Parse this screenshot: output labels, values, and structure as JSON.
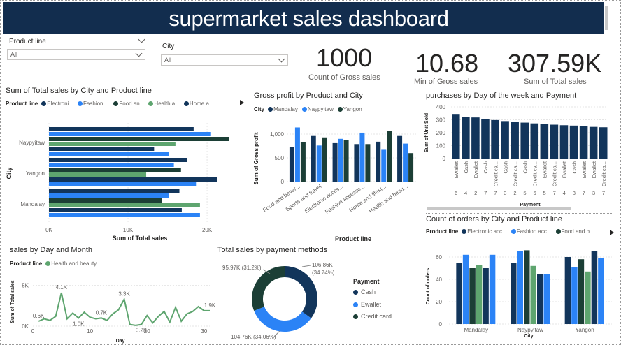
{
  "header": {
    "title": "supermarket sales dashboard"
  },
  "slicers": {
    "product_line": {
      "label": "Product line",
      "value": "All"
    },
    "city": {
      "label": "City",
      "value": "All"
    }
  },
  "kpis": [
    {
      "value": "1000",
      "label": "Count of Gross sales"
    },
    {
      "value": "10.68",
      "label": "Min of Gross sales"
    },
    {
      "value": "307.59K",
      "label": "Sum of Total sales"
    }
  ],
  "colors": {
    "navy": "#12355b",
    "blue": "#2b83f6",
    "darkgreen": "#1c3f36",
    "green": "#5ea56f",
    "titlebar": "#122d4e"
  },
  "visual1": {
    "title": "Sum of Total sales by City and Product line",
    "legend_title": "Product line",
    "legend": [
      "Electroni...",
      "Fashion ...",
      "Food an...",
      "Health a...",
      "Home a..."
    ],
    "xlabel": "Sum of Total sales",
    "ylabel": "City",
    "xticks": [
      "0K",
      "10K",
      "20K"
    ]
  },
  "visual2": {
    "title": "Gross profit by Product and City",
    "legend_title": "City",
    "legend": [
      "Mandalay",
      "Naypyitaw",
      "Yangon"
    ],
    "xlabel": "Product line",
    "ylabel": "Sum of Gross profit",
    "yticks": [
      "0",
      "500",
      "1,000"
    ]
  },
  "visual3": {
    "title": "purchases by Day of the week and Payment",
    "xlabel": "Payment",
    "ylabel": "Sum of Unit Sold",
    "yticks": [
      "0",
      "100",
      "200",
      "300",
      "400"
    ]
  },
  "visual4": {
    "title": "sales by Day and Month",
    "legend_title": "Product line",
    "legend": [
      "Health and beauty"
    ],
    "xlabel": "Day",
    "ylabel": "Sum of Total sales",
    "yticks": [
      "0K",
      "5K"
    ],
    "xticks": [
      "0",
      "10",
      "20",
      "30"
    ]
  },
  "visual5": {
    "title": "Total sales by payment methods",
    "legend_title": "Payment",
    "legend": [
      "Cash",
      "Ewallet",
      "Credit card"
    ],
    "labels": [
      {
        "line1": "106.86K",
        "line2": "(34.74%)"
      },
      {
        "line1": "95.97K (31.2%)"
      },
      {
        "line1": "104.76K (34.06%)"
      }
    ]
  },
  "visual6": {
    "title": "Count of orders by City and Product line",
    "legend_title": "Product line",
    "legend": [
      "Electronic acc...",
      "Fashion acc...",
      "Food and b..."
    ],
    "xlabel": "City",
    "ylabel": "Count of orders",
    "yticks": [
      "0",
      "20",
      "40",
      "60"
    ]
  },
  "chart_data": [
    {
      "type": "bar",
      "title": "Sum of Total sales by City and Product line",
      "orientation": "horizontal",
      "categories": [
        "Naypyitaw",
        "Yangon",
        "Mandalay"
      ],
      "series": [
        {
          "name": "Electroni...",
          "values": [
            18300,
            17500,
            16500
          ]
        },
        {
          "name": "Fashion ...",
          "values": [
            20500,
            15800,
            15200
          ]
        },
        {
          "name": "Food an...",
          "values": [
            22800,
            16700,
            14300
          ]
        },
        {
          "name": "Health a...",
          "values": [
            16000,
            12300,
            19100
          ]
        },
        {
          "name": "Home a...",
          "values": [
            13300,
            21300,
            16800
          ]
        },
        {
          "name": "",
          "values": [
            15200,
            18600,
            19100
          ]
        }
      ],
      "xlim": [
        0,
        23000
      ]
    },
    {
      "type": "bar",
      "title": "Gross profit by Product and City",
      "categories": [
        "Food and bever...",
        "Sports and travel",
        "Electronic acces...",
        "Fashion accesso...",
        "Home and lifest...",
        "Health and beau..."
      ],
      "series": [
        {
          "name": "Mandalay",
          "values": [
            730,
            960,
            810,
            790,
            840,
            960
          ]
        },
        {
          "name": "Naypyitaw",
          "values": [
            1140,
            760,
            900,
            1030,
            670,
            800
          ]
        },
        {
          "name": "Yangon",
          "values": [
            830,
            930,
            870,
            790,
            1060,
            600
          ]
        }
      ],
      "ylim": [
        0,
        1250
      ]
    },
    {
      "type": "bar",
      "title": "purchases by Day of the week and Payment",
      "categories": [
        "Ewallet 6",
        "Cash 4",
        "Ewallet 2",
        "Cash 7",
        "Credit ca... 7",
        "Cash 3",
        "Credit ca... 2",
        "Cash 5",
        "Credit ca... 6",
        "Ewallet 5",
        "Credit ca... 7",
        "Ewallet 4",
        "Cash 3",
        "Ewallet 7",
        "Ewallet 3",
        "Credit ca... 7"
      ],
      "values": [
        345,
        322,
        318,
        305,
        298,
        290,
        284,
        278,
        272,
        267,
        262,
        258,
        255,
        250,
        245,
        242
      ],
      "ylim": [
        0,
        400
      ]
    },
    {
      "type": "line",
      "title": "sales by Day and Month",
      "series": [
        {
          "name": "Health and beauty",
          "x": [
            1,
            2,
            3,
            4,
            5,
            6,
            7,
            8,
            9,
            10,
            11,
            12,
            13,
            14,
            15,
            16,
            17,
            18,
            19,
            20,
            21,
            22,
            23,
            24,
            25,
            26,
            27,
            28,
            29,
            30,
            31
          ],
          "values": [
            600,
            900,
            700,
            1200,
            4100,
            900,
            1600,
            1000,
            1700,
            1100,
            900,
            1000,
            700,
            1500,
            2000,
            3300,
            200,
            100,
            200,
            1300,
            400,
            1200,
            1800,
            500,
            2300,
            600,
            1500,
            1800,
            2400,
            1900,
            1900
          ]
        }
      ],
      "xlim": [
        0,
        31
      ],
      "ylim": [
        0,
        6000
      ]
    },
    {
      "type": "pie",
      "title": "Total sales by payment methods",
      "categories": [
        "Cash",
        "Ewallet",
        "Credit card"
      ],
      "values": [
        106.86,
        104.76,
        95.97
      ],
      "percents": [
        34.74,
        34.06,
        31.2
      ]
    },
    {
      "type": "bar",
      "title": "Count of orders by City and Product line",
      "categories": [
        "Mandalay",
        "Naypyitaw",
        "Yangon"
      ],
      "series": [
        {
          "name": "Electronic acc...",
          "values": [
            55,
            55,
            60
          ]
        },
        {
          "name": "Fashion acc...",
          "values": [
            62,
            65,
            51
          ]
        },
        {
          "name": "Food and b...",
          "values": [
            50,
            66,
            58
          ]
        },
        {
          "name": "",
          "values": [
            53,
            52,
            47
          ]
        },
        {
          "name": "",
          "values": [
            50,
            45,
            65
          ]
        },
        {
          "name": "",
          "values": [
            62,
            45,
            59
          ]
        }
      ],
      "ylim": [
        0,
        70
      ]
    }
  ]
}
